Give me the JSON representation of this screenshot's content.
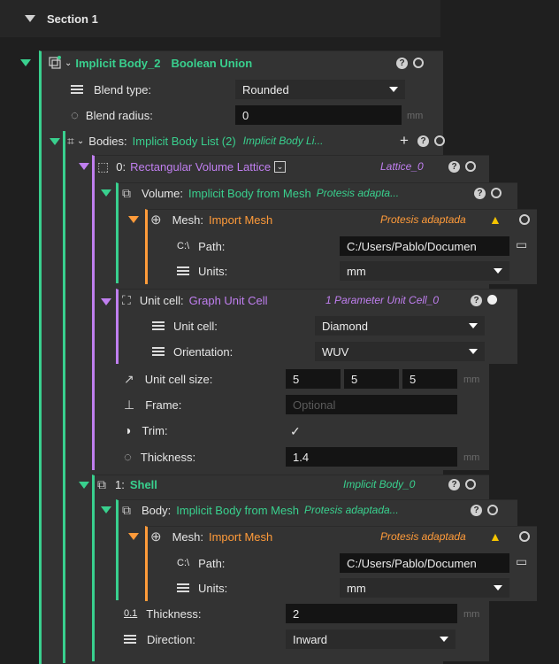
{
  "section": {
    "title": "Section 1"
  },
  "root": {
    "name": "Implicit Body_2",
    "type": "Boolean Union",
    "blend_type_label": "Blend type:",
    "blend_type_value": "Rounded",
    "blend_radius_label": "Blend radius:",
    "blend_radius_value": "0",
    "blend_radius_unit": "mm"
  },
  "bodies": {
    "label": "Bodies:",
    "type": "Implicit Body List (2)",
    "name": "Implicit Body Li..."
  },
  "lattice": {
    "index": "0:",
    "type": "Rectangular Volume Lattice",
    "name": "Lattice_0",
    "volume": {
      "label": "Volume:",
      "type": "Implicit Body from Mesh",
      "name": "Protesis adapta..."
    },
    "mesh": {
      "label": "Mesh:",
      "type": "Import Mesh",
      "name": "Protesis adaptada",
      "path_label": "Path:",
      "path_value": "C:/Users/Pablo/Documen",
      "units_label": "Units:",
      "units_value": "mm"
    },
    "unitcell": {
      "label": "Unit cell:",
      "type": "Graph Unit Cell",
      "name": "1 Parameter Unit Cell_0",
      "cell_label": "Unit cell:",
      "cell_value": "Diamond",
      "orient_label": "Orientation:",
      "orient_value": "WUV"
    },
    "size_label": "Unit cell size:",
    "size_values": [
      "5",
      "5",
      "5"
    ],
    "size_unit": "mm",
    "frame_label": "Frame:",
    "frame_placeholder": "Optional",
    "trim_label": "Trim:",
    "trim_value": "✓",
    "thickness_label": "Thickness:",
    "thickness_value": "1.4",
    "thickness_unit": "mm"
  },
  "shell": {
    "index": "1:",
    "type": "Shell",
    "name": "Implicit Body_0",
    "body": {
      "label": "Body:",
      "type": "Implicit Body from Mesh",
      "name": "Protesis adaptada..."
    },
    "mesh": {
      "label": "Mesh:",
      "type": "Import Mesh",
      "name": "Protesis adaptada",
      "path_label": "Path:",
      "path_value": "C:/Users/Pablo/Documen",
      "units_label": "Units:",
      "units_value": "mm"
    },
    "thickness_label": "Thickness:",
    "thickness_value": "2",
    "thickness_unit": "mm",
    "direction_label": "Direction:",
    "direction_value": "Inward"
  },
  "icons": {
    "help": "?",
    "path_prefix": "C:\\",
    "thickness_prefix": "0.1",
    "add": "+"
  },
  "colors": {
    "green": "#39d08e",
    "purple": "#c07ff0",
    "orange": "#ff9b3a",
    "warning": "#f5c400"
  }
}
